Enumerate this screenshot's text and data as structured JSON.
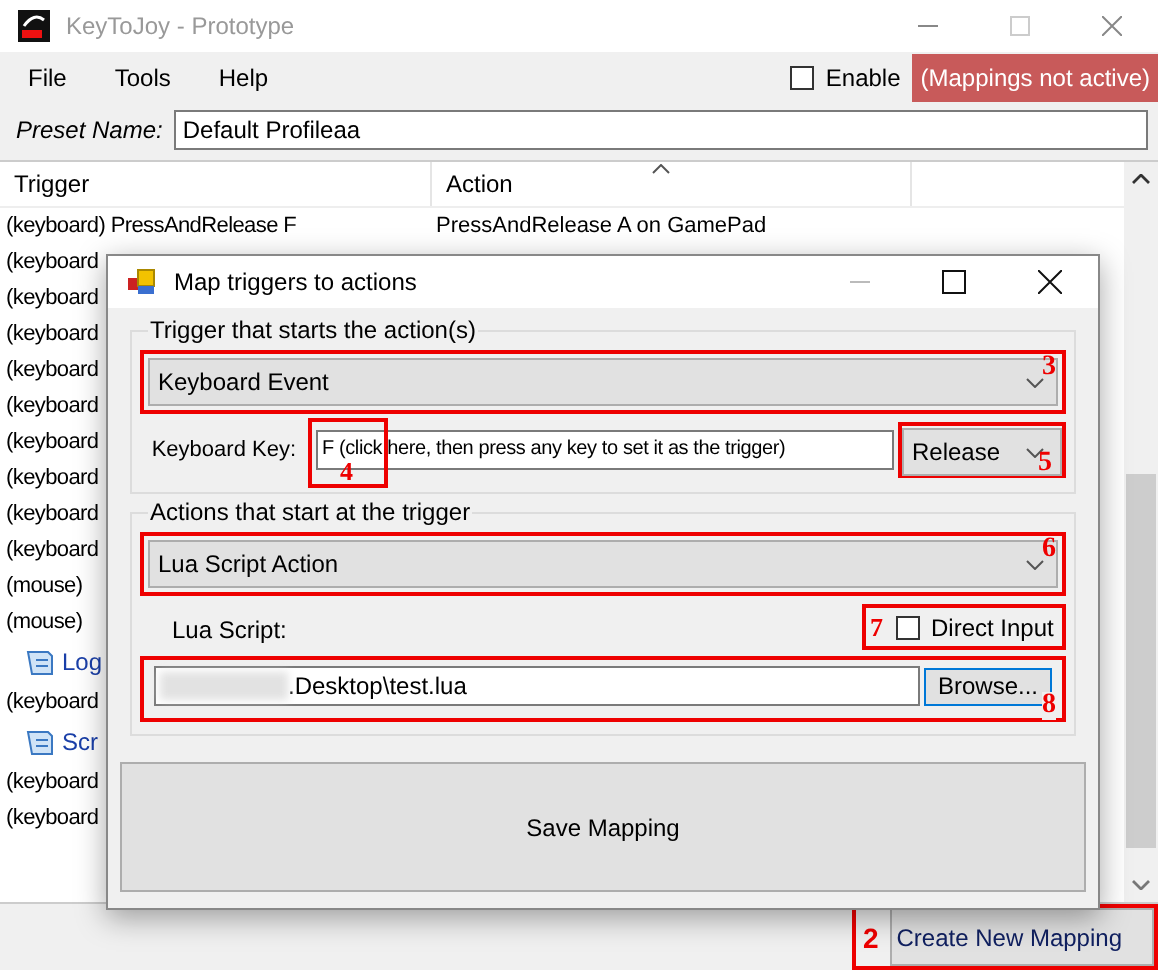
{
  "window": {
    "title": "KeyToJoy - Prototype"
  },
  "menu": [
    "File",
    "Tools",
    "Help"
  ],
  "enable": {
    "label": "Enable",
    "checked": false
  },
  "status": "(Mappings not active)",
  "preset": {
    "label": "Preset Name:",
    "value": "Default Profileaa"
  },
  "table": {
    "columns": [
      "Trigger",
      "Action"
    ],
    "rows": [
      {
        "kind": "row",
        "trigger": "(keyboard) PressAndRelease F",
        "action": "PressAndRelease A on GamePad"
      },
      {
        "kind": "row",
        "trigger": "(keyboard"
      },
      {
        "kind": "row",
        "trigger": "(keyboard"
      },
      {
        "kind": "row",
        "trigger": "(keyboard"
      },
      {
        "kind": "row",
        "trigger": "(keyboard"
      },
      {
        "kind": "row",
        "trigger": "(keyboard"
      },
      {
        "kind": "row",
        "trigger": "(keyboard"
      },
      {
        "kind": "row",
        "trigger": "(keyboard"
      },
      {
        "kind": "row",
        "trigger": "(keyboard"
      },
      {
        "kind": "row",
        "trigger": "(keyboard"
      },
      {
        "kind": "row",
        "trigger": "(mouse)"
      },
      {
        "kind": "row",
        "trigger": "(mouse)"
      },
      {
        "kind": "group",
        "trigger": "Log"
      },
      {
        "kind": "row",
        "trigger": "(keyboard"
      },
      {
        "kind": "group",
        "trigger": "Scr"
      },
      {
        "kind": "row",
        "trigger": "(keyboard"
      },
      {
        "kind": "row",
        "trigger": "(keyboard"
      }
    ]
  },
  "dialog": {
    "title": "Map triggers to actions",
    "trigger_group": {
      "title": "Trigger that starts the action(s)",
      "event_type": {
        "value": "Keyboard Event",
        "annotation": "3"
      },
      "key_label": "Keyboard Key:",
      "key_value": {
        "value": "F (click here, then press any key to set it as the trigger)",
        "annotation": "4"
      },
      "key_mode": {
        "value": "Release",
        "annotation": "5"
      }
    },
    "action_group": {
      "title": "Actions that start at the trigger",
      "action_type": {
        "value": "Lua Script Action",
        "annotation": "6"
      },
      "script_label": "Lua Script:",
      "direct_input": {
        "label": "Direct Input",
        "checked": false,
        "annotation": "7"
      },
      "script_path": {
        "value": ".Desktop\\test.lua",
        "annotation": "8"
      },
      "browse": "Browse..."
    },
    "save": "Save Mapping"
  },
  "create_button": {
    "label": "Create New Mapping",
    "annotation": "2"
  }
}
